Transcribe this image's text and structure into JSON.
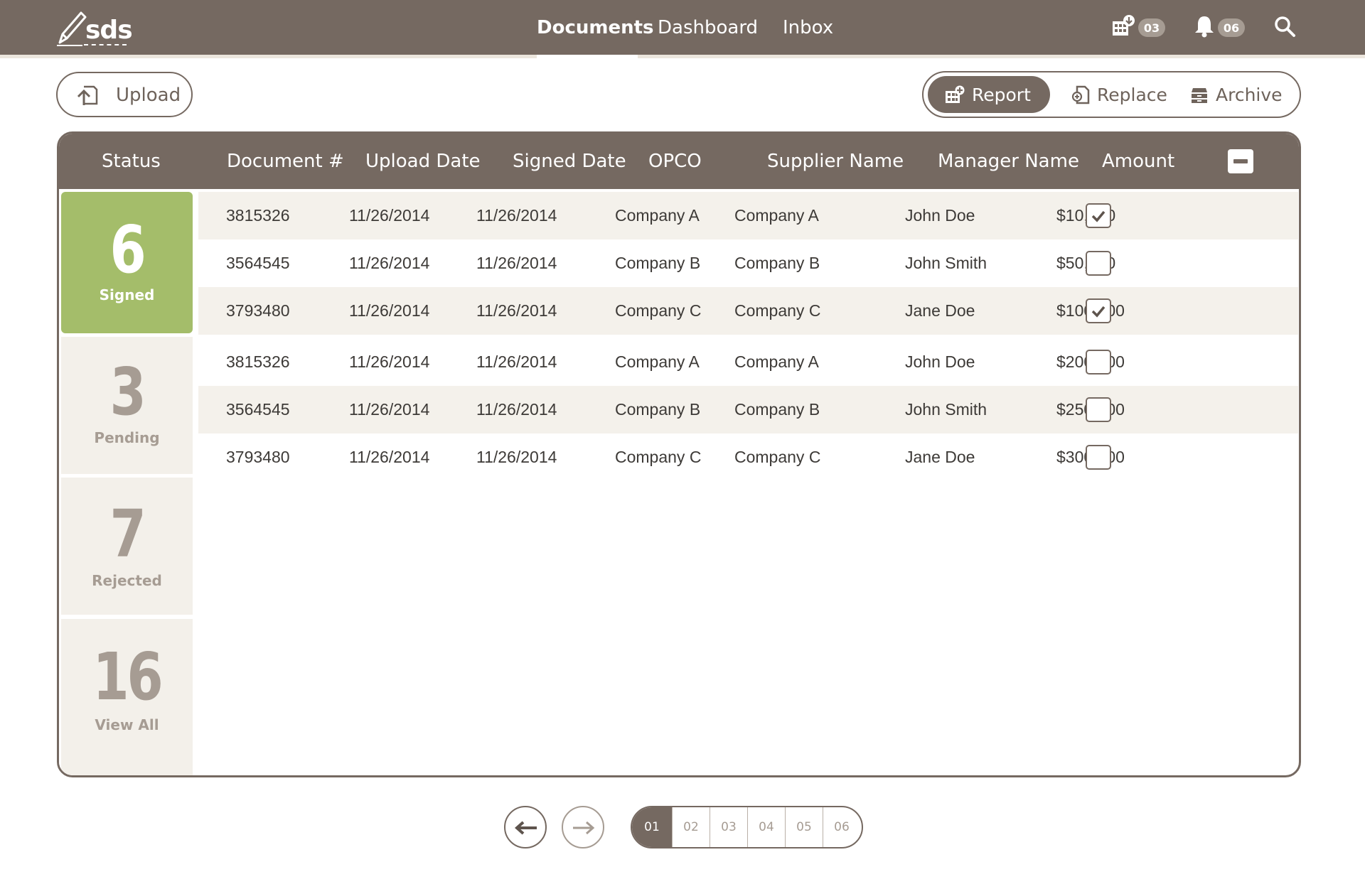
{
  "app": {
    "logo_text": "sds"
  },
  "nav": {
    "items": [
      {
        "label": "Documents",
        "active": true
      },
      {
        "label": "Dashboard",
        "active": false
      },
      {
        "label": "Inbox",
        "active": false
      }
    ]
  },
  "header_icons": {
    "reports_badge": "03",
    "notifications_badge": "06"
  },
  "toolbar": {
    "upload_label": "Upload",
    "report_label": "Report",
    "replace_label": "Replace",
    "archive_label": "Archive"
  },
  "table": {
    "columns": [
      "Status",
      "Document #",
      "Upload Date",
      "Signed Date",
      "OPCO",
      "Supplier Name",
      "Manager Name",
      "Amount"
    ],
    "rows": [
      {
        "doc": "3815326",
        "upload": "11/26/2014",
        "signed": "11/26/2014",
        "opco": "Company A",
        "supplier": "Company A",
        "manager": "John Doe",
        "amount": "$10,000",
        "checked": true
      },
      {
        "doc": "3564545",
        "upload": "11/26/2014",
        "signed": "11/26/2014",
        "opco": "Company B",
        "supplier": "Company B",
        "manager": "John Smith",
        "amount": "$50,000",
        "checked": false
      },
      {
        "doc": "3793480",
        "upload": "11/26/2014",
        "signed": "11/26/2014",
        "opco": "Company C",
        "supplier": "Company C",
        "manager": "Jane Doe",
        "amount": "$100,000",
        "checked": true
      },
      {
        "doc": "3815326",
        "upload": "11/26/2014",
        "signed": "11/26/2014",
        "opco": "Company A",
        "supplier": "Company A",
        "manager": "John Doe",
        "amount": "$200,000",
        "checked": false
      },
      {
        "doc": "3564545",
        "upload": "11/26/2014",
        "signed": "11/26/2014",
        "opco": "Company B",
        "supplier": "Company B",
        "manager": "John Smith",
        "amount": "$250,000",
        "checked": false
      },
      {
        "doc": "3793480",
        "upload": "11/26/2014",
        "signed": "11/26/2014",
        "opco": "Company C",
        "supplier": "Company C",
        "manager": "Jane Doe",
        "amount": "$300,000",
        "checked": false
      }
    ]
  },
  "status_filters": [
    {
      "count": "6",
      "label": "Signed",
      "active": true
    },
    {
      "count": "3",
      "label": "Pending",
      "active": false
    },
    {
      "count": "7",
      "label": "Rejected",
      "active": false
    },
    {
      "count": "16",
      "label": "View All",
      "active": false
    }
  ],
  "pagination": {
    "pages": [
      "01",
      "02",
      "03",
      "04",
      "05",
      "06"
    ],
    "current": "01"
  },
  "colors": {
    "brand": "#756961",
    "accent_green": "#a4bd6a",
    "row_shade": "#f4f1eb",
    "muted": "#a69c93"
  }
}
